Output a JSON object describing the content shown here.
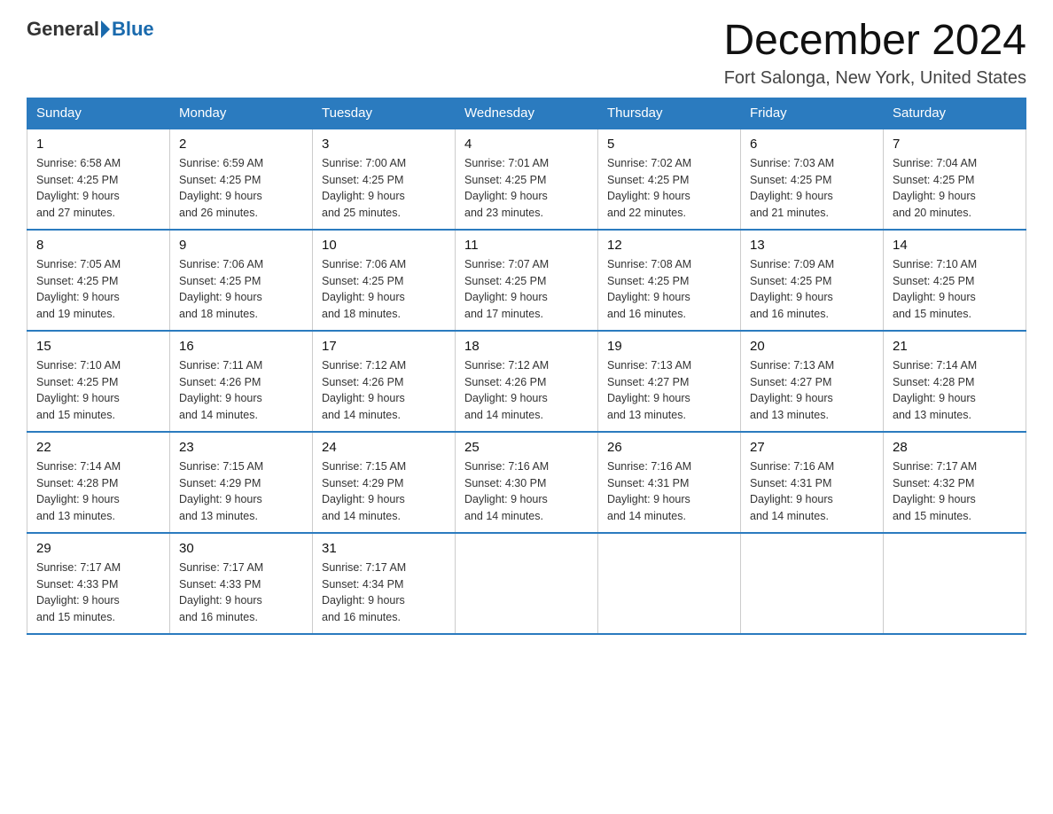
{
  "header": {
    "logo_general": "General",
    "logo_blue": "Blue",
    "month_title": "December 2024",
    "location": "Fort Salonga, New York, United States"
  },
  "weekdays": [
    "Sunday",
    "Monday",
    "Tuesday",
    "Wednesday",
    "Thursday",
    "Friday",
    "Saturday"
  ],
  "weeks": [
    [
      {
        "date": "1",
        "sunrise": "6:58 AM",
        "sunset": "4:25 PM",
        "daylight": "9 hours and 27 minutes."
      },
      {
        "date": "2",
        "sunrise": "6:59 AM",
        "sunset": "4:25 PM",
        "daylight": "9 hours and 26 minutes."
      },
      {
        "date": "3",
        "sunrise": "7:00 AM",
        "sunset": "4:25 PM",
        "daylight": "9 hours and 25 minutes."
      },
      {
        "date": "4",
        "sunrise": "7:01 AM",
        "sunset": "4:25 PM",
        "daylight": "9 hours and 23 minutes."
      },
      {
        "date": "5",
        "sunrise": "7:02 AM",
        "sunset": "4:25 PM",
        "daylight": "9 hours and 22 minutes."
      },
      {
        "date": "6",
        "sunrise": "7:03 AM",
        "sunset": "4:25 PM",
        "daylight": "9 hours and 21 minutes."
      },
      {
        "date": "7",
        "sunrise": "7:04 AM",
        "sunset": "4:25 PM",
        "daylight": "9 hours and 20 minutes."
      }
    ],
    [
      {
        "date": "8",
        "sunrise": "7:05 AM",
        "sunset": "4:25 PM",
        "daylight": "9 hours and 19 minutes."
      },
      {
        "date": "9",
        "sunrise": "7:06 AM",
        "sunset": "4:25 PM",
        "daylight": "9 hours and 18 minutes."
      },
      {
        "date": "10",
        "sunrise": "7:06 AM",
        "sunset": "4:25 PM",
        "daylight": "9 hours and 18 minutes."
      },
      {
        "date": "11",
        "sunrise": "7:07 AM",
        "sunset": "4:25 PM",
        "daylight": "9 hours and 17 minutes."
      },
      {
        "date": "12",
        "sunrise": "7:08 AM",
        "sunset": "4:25 PM",
        "daylight": "9 hours and 16 minutes."
      },
      {
        "date": "13",
        "sunrise": "7:09 AM",
        "sunset": "4:25 PM",
        "daylight": "9 hours and 16 minutes."
      },
      {
        "date": "14",
        "sunrise": "7:10 AM",
        "sunset": "4:25 PM",
        "daylight": "9 hours and 15 minutes."
      }
    ],
    [
      {
        "date": "15",
        "sunrise": "7:10 AM",
        "sunset": "4:25 PM",
        "daylight": "9 hours and 15 minutes."
      },
      {
        "date": "16",
        "sunrise": "7:11 AM",
        "sunset": "4:26 PM",
        "daylight": "9 hours and 14 minutes."
      },
      {
        "date": "17",
        "sunrise": "7:12 AM",
        "sunset": "4:26 PM",
        "daylight": "9 hours and 14 minutes."
      },
      {
        "date": "18",
        "sunrise": "7:12 AM",
        "sunset": "4:26 PM",
        "daylight": "9 hours and 14 minutes."
      },
      {
        "date": "19",
        "sunrise": "7:13 AM",
        "sunset": "4:27 PM",
        "daylight": "9 hours and 13 minutes."
      },
      {
        "date": "20",
        "sunrise": "7:13 AM",
        "sunset": "4:27 PM",
        "daylight": "9 hours and 13 minutes."
      },
      {
        "date": "21",
        "sunrise": "7:14 AM",
        "sunset": "4:28 PM",
        "daylight": "9 hours and 13 minutes."
      }
    ],
    [
      {
        "date": "22",
        "sunrise": "7:14 AM",
        "sunset": "4:28 PM",
        "daylight": "9 hours and 13 minutes."
      },
      {
        "date": "23",
        "sunrise": "7:15 AM",
        "sunset": "4:29 PM",
        "daylight": "9 hours and 13 minutes."
      },
      {
        "date": "24",
        "sunrise": "7:15 AM",
        "sunset": "4:29 PM",
        "daylight": "9 hours and 14 minutes."
      },
      {
        "date": "25",
        "sunrise": "7:16 AM",
        "sunset": "4:30 PM",
        "daylight": "9 hours and 14 minutes."
      },
      {
        "date": "26",
        "sunrise": "7:16 AM",
        "sunset": "4:31 PM",
        "daylight": "9 hours and 14 minutes."
      },
      {
        "date": "27",
        "sunrise": "7:16 AM",
        "sunset": "4:31 PM",
        "daylight": "9 hours and 14 minutes."
      },
      {
        "date": "28",
        "sunrise": "7:17 AM",
        "sunset": "4:32 PM",
        "daylight": "9 hours and 15 minutes."
      }
    ],
    [
      {
        "date": "29",
        "sunrise": "7:17 AM",
        "sunset": "4:33 PM",
        "daylight": "9 hours and 15 minutes."
      },
      {
        "date": "30",
        "sunrise": "7:17 AM",
        "sunset": "4:33 PM",
        "daylight": "9 hours and 16 minutes."
      },
      {
        "date": "31",
        "sunrise": "7:17 AM",
        "sunset": "4:34 PM",
        "daylight": "9 hours and 16 minutes."
      },
      null,
      null,
      null,
      null
    ]
  ],
  "labels": {
    "sunrise": "Sunrise:",
    "sunset": "Sunset:",
    "daylight": "Daylight:"
  }
}
